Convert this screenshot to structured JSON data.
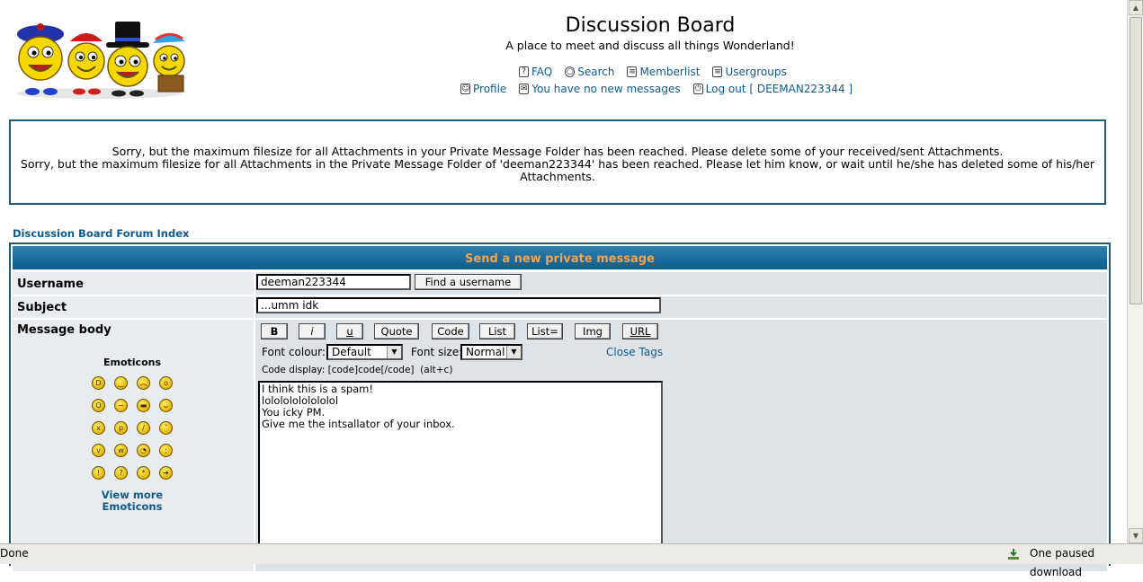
{
  "header": {
    "title": "Discussion Board",
    "subtitle": "A place to meet and discuss all things Wonderland!",
    "nav_row1": [
      {
        "label": "FAQ",
        "icon": "faq-icon"
      },
      {
        "label": "Search",
        "icon": "search-icon"
      },
      {
        "label": "Memberlist",
        "icon": "memberlist-icon"
      },
      {
        "label": "Usergroups",
        "icon": "usergroups-icon"
      }
    ],
    "nav_row2": [
      {
        "label": "Profile",
        "icon": "profile-icon"
      },
      {
        "label": "You have no new messages",
        "icon": "messages-icon"
      },
      {
        "label": "Log out [ DEEMAN223344 ]",
        "icon": "logout-icon"
      }
    ]
  },
  "notice": {
    "line1": "Sorry, but the maximum filesize for all Attachments in your Private Message Folder has been reached. Please delete some of your received/sent Attachments.",
    "line2": "Sorry, but the maximum filesize for all Attachments in the Private Message Folder of 'deeman223344' has been reached. Please let him know, or wait until he/she has deleted some of his/her Attachments."
  },
  "breadcrumb": "Discussion Board Forum Index",
  "form": {
    "heading": "Send a new private message",
    "username_label": "Username",
    "username_value": "deeman223344",
    "find_button": "Find a username",
    "subject_label": "Subject",
    "subject_value": "...umm idk",
    "body_label": "Message body",
    "format_buttons": [
      "B",
      "i",
      "u",
      "Quote",
      "Code",
      "List",
      "List=",
      "Img",
      "URL"
    ],
    "font_colour_label": "Font colour:",
    "font_colour_value": "Default",
    "font_size_label": "Font size:",
    "font_size_value": "Normal",
    "close_tags": "Close Tags",
    "code_display_hint": "Code display: [code]code[/code]  (alt+c)",
    "message": "I think this is a spam!\nlolololololololol\nYou icky PM.\nGive me the intsallator of your inbox.",
    "emoticons_title": "Emoticons",
    "view_more": [
      "View more",
      "Emoticons"
    ]
  },
  "emoticons": [
    "big-grin",
    "smile",
    "sad",
    "surprised",
    "shocked",
    "confused",
    "cool",
    "laughing",
    "mad",
    "razz",
    "embarrassed",
    "crying",
    "evil",
    "twisted",
    "rolling-eyes",
    "wink",
    "exclamation",
    "question",
    "idea",
    "arrow"
  ],
  "statusbar": {
    "left": "Done",
    "right": "One paused download"
  },
  "colors": {
    "header_bar": "#1e6a9c",
    "header_text": "#f3a34b",
    "link": "#0f5a90",
    "border": "#1e5a7a"
  }
}
